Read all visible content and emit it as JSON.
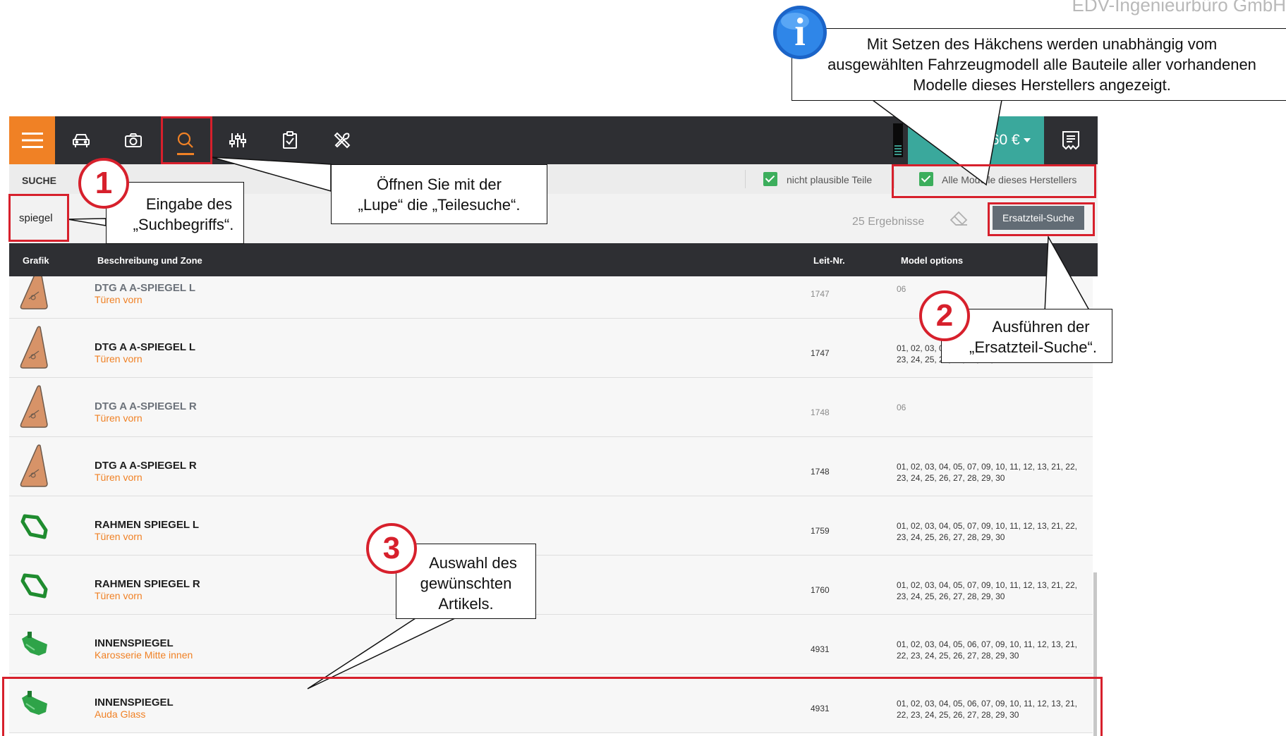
{
  "brand": "EDV-Ingenieurbüro GmbH",
  "toolbar": {
    "icons": [
      "menu-icon",
      "car-icon",
      "camera-icon",
      "search-icon",
      "sliders-icon",
      "clipboard-check-icon",
      "tools-icon",
      "receipt-icon"
    ],
    "cart_amount": ",60 €",
    "accent_color": "#f08125",
    "bar_color": "#2e2f33",
    "cart_color": "#3aa89c"
  },
  "subbar": {
    "title": "SUCHE",
    "checkbox_implausible_label": "nicht plausible Teile",
    "checkbox_implausible_checked": true,
    "checkbox_all_models_label": "Alle Modelle dieses Herstellers",
    "checkbox_all_models_checked": true
  },
  "search": {
    "value": "spiegel",
    "results_count": "25 Ergebnisse",
    "button_label": "Ersatzteil-Suche"
  },
  "table": {
    "headers": {
      "graphic": "Grafik",
      "description": "Beschreibung und Zone",
      "leit": "Leit-Nr.",
      "options": "Model options"
    },
    "rows": [
      {
        "title": "DTG A A-SPIEGEL L",
        "zone": "Türen vorn",
        "leit": "1747",
        "options": "06",
        "dim": true,
        "shape": "triangle"
      },
      {
        "title": "DTG A A-SPIEGEL L",
        "zone": "Türen vorn",
        "leit": "1747",
        "options": "01, 02, 03, 04, 05, 07, 09, 10, 11, 12, 13, 21, 22, 23, 24, 25, 26, 27, 28, 29, 30",
        "dim": false,
        "shape": "triangle"
      },
      {
        "title": "DTG A A-SPIEGEL R",
        "zone": "Türen vorn",
        "leit": "1748",
        "options": "06",
        "dim": true,
        "shape": "triangle"
      },
      {
        "title": "DTG A A-SPIEGEL R",
        "zone": "Türen vorn",
        "leit": "1748",
        "options": "01, 02, 03, 04, 05, 07, 09, 10, 11, 12, 13, 21, 22, 23, 24, 25, 26, 27, 28, 29, 30",
        "dim": false,
        "shape": "triangle"
      },
      {
        "title": "RAHMEN SPIEGEL L",
        "zone": "Türen vorn",
        "leit": "1759",
        "options": "01, 02, 03, 04, 05, 07, 09, 10, 11, 12, 13, 21, 22, 23, 24, 25, 26, 27, 28, 29, 30",
        "dim": false,
        "shape": "frame"
      },
      {
        "title": "RAHMEN SPIEGEL R",
        "zone": "Türen vorn",
        "leit": "1760",
        "options": "01, 02, 03, 04, 05, 07, 09, 10, 11, 12, 13, 21, 22, 23, 24, 25, 26, 27, 28, 29, 30",
        "dim": false,
        "shape": "frame"
      },
      {
        "title": "INNENSPIEGEL",
        "zone": "Karosserie Mitte innen",
        "leit": "4931",
        "options": "01, 02, 03, 04, 05, 06, 07, 09, 10, 11, 12, 13, 21, 22, 23, 24, 25, 26, 27, 28, 29, 30",
        "dim": false,
        "shape": "mirror"
      },
      {
        "title": "INNENSPIEGEL",
        "zone": "Auda Glass",
        "leit": "4931",
        "options": "01, 02, 03, 04, 05, 06, 07, 09, 10, 11, 12, 13, 21, 22, 23, 24, 25, 26, 27, 28, 29, 30",
        "dim": false,
        "shape": "mirror"
      }
    ]
  },
  "callouts": {
    "info_text_line1": "Mit Setzen des Häkchens werden unabhängig vom",
    "info_text_line2": "ausgewählten Fahrzeugmodell alle Bauteile aller vorhandenen",
    "info_text_line3": "Modelle dieses Herstellers angezeigt.",
    "info_letter": "i",
    "c1_number": "1",
    "c1_line1": "Eingabe des",
    "c1_line2": "„Suchbegriffs“.",
    "lupe_line1": "Öffnen Sie mit der",
    "lupe_line2": "„Lupe“ die „Teilesuche“.",
    "c2_number": "2",
    "c2_line1": "Ausführen der",
    "c2_line2": "„Ersatzteil-Suche“.",
    "c3_number": "3",
    "c3_line1": "Auswahl des",
    "c3_line2": "gewünschten",
    "c3_line3": "Artikels.",
    "highlight_color": "#d7202c"
  }
}
